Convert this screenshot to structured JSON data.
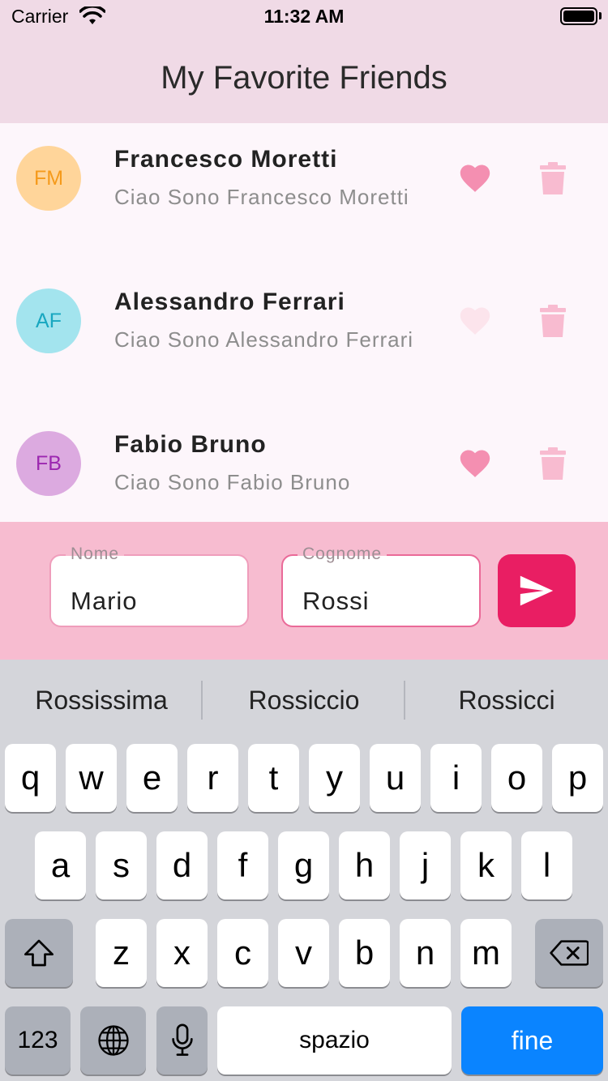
{
  "status_bar": {
    "carrier": "Carrier",
    "time": "11:32 AM"
  },
  "header": {
    "title": "My Favorite Friends"
  },
  "friends": [
    {
      "initials": "FM",
      "name": "Francesco Moretti",
      "subtitle": "Ciao Sono Francesco Moretti",
      "favorite": true,
      "avatar_bg": "#ffd59a",
      "avatar_fg": "#f59a1b"
    },
    {
      "initials": "AF",
      "name": "Alessandro Ferrari",
      "subtitle": "Ciao Sono Alessandro Ferrari",
      "favorite": false,
      "avatar_bg": "#a3e4ee",
      "avatar_fg": "#18a7c0"
    },
    {
      "initials": "FB",
      "name": "Fabio Bruno",
      "subtitle": "Ciao Sono Fabio Bruno",
      "favorite": true,
      "avatar_bg": "#dcaae0",
      "avatar_fg": "#9c27b0"
    }
  ],
  "form": {
    "first_name": {
      "label": "Nome",
      "value": "Mario"
    },
    "last_name": {
      "label": "Cognome",
      "value": "Rossi"
    },
    "send_icon": "send-icon"
  },
  "keyboard": {
    "suggestions": [
      "Rossissima",
      "Rossiccio",
      "Rossicci"
    ],
    "row1": [
      "q",
      "w",
      "e",
      "r",
      "t",
      "y",
      "u",
      "i",
      "o",
      "p"
    ],
    "row2": [
      "a",
      "s",
      "d",
      "f",
      "g",
      "h",
      "j",
      "k",
      "l"
    ],
    "row3": [
      "z",
      "x",
      "c",
      "v",
      "b",
      "n",
      "m"
    ],
    "numbers_label": "123",
    "space_label": "spazio",
    "done_label": "fine",
    "icons": {
      "shift": "shift-icon",
      "backspace": "backspace-icon",
      "globe": "globe-icon",
      "mic": "microphone-icon"
    }
  },
  "colors": {
    "header_bg": "#f0dae6",
    "heart_on": "#f48fb1",
    "heart_off": "#fce4ec",
    "trash": "#f8bbd0",
    "input_bar_bg": "#f7bcd0",
    "accent": "#e91e63",
    "done_key": "#0a84ff"
  }
}
